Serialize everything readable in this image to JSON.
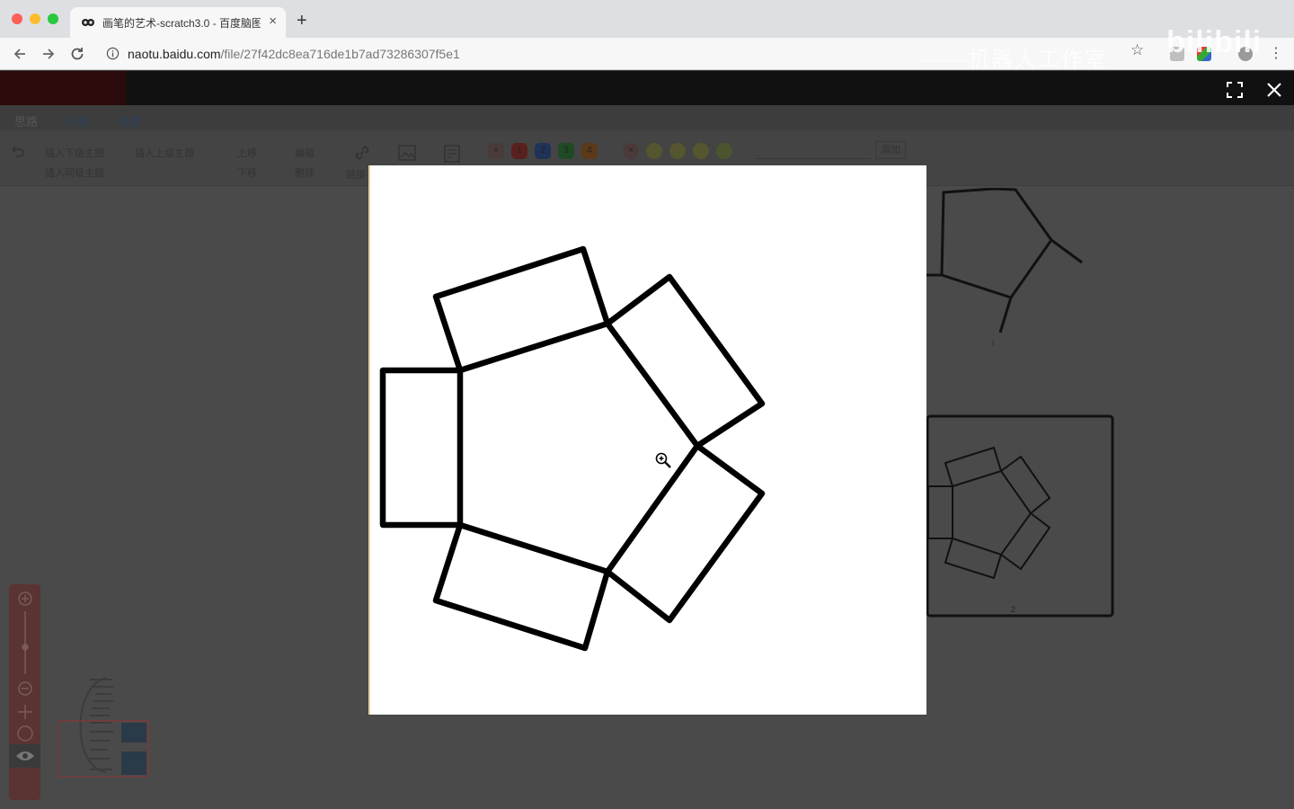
{
  "browser": {
    "tab_title": "画笔的艺术-scratch3.0 - 百度脑图",
    "tab_close": "×",
    "new_tab": "+",
    "url_host": "naotu.baidu.com",
    "url_path": "/file/27f42dc8ea716de1b7ad73286307f5e1",
    "watermark": "——机器人工作室",
    "bilibili_logo": "bilibili",
    "star": "☆",
    "menu": "⋮"
  },
  "app": {
    "ribbon_tabs": [
      "思路",
      "外观",
      "视图"
    ],
    "ribbon_buttons": {
      "insert_child": "插入下级主题",
      "insert_parent": "插入上级主题",
      "insert_sibling": "插入同级主题",
      "move_up": "上移",
      "move_down": "下移",
      "edit": "编辑",
      "delete": "删除",
      "link": "链接",
      "add": "添加"
    },
    "priorities": [
      "1",
      "2",
      "3",
      "4"
    ],
    "canvas_label": "2"
  },
  "colors": {
    "accent": "#e74c3c",
    "priority_1": "#c0392b",
    "priority_2": "#2c5fb6",
    "priority_3": "#2e9b3a",
    "priority_4": "#e08a1e"
  },
  "icons": [
    "back-icon",
    "forward-icon",
    "reload-icon",
    "info-icon",
    "star-icon",
    "fullscreen-icon",
    "close-icon",
    "zoom-in-cursor-icon"
  ]
}
